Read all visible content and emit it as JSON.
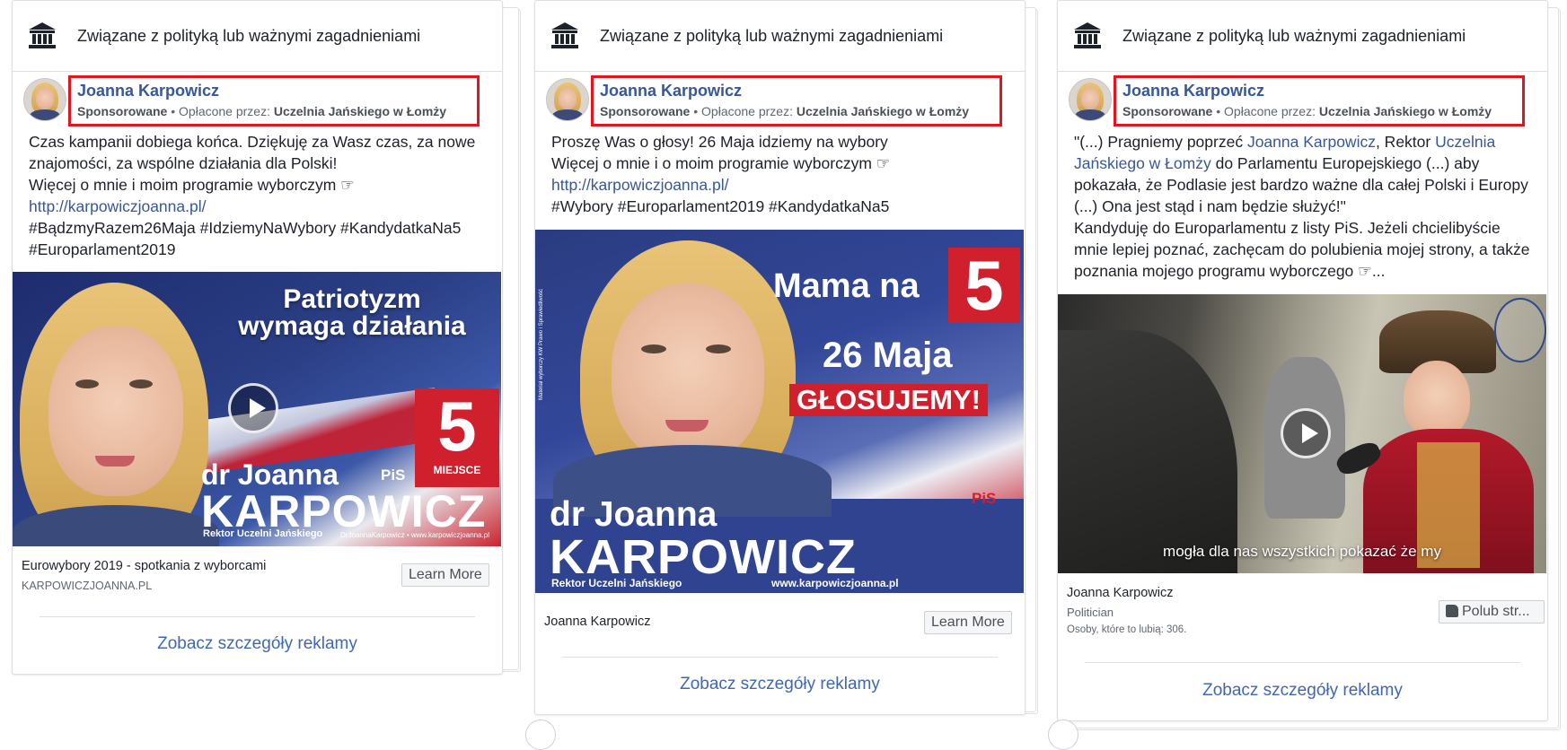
{
  "cards": [
    {
      "topbar_text": "Związane z polityką lub ważnymi zagadnieniami",
      "page_name": "Joanna Karpowicz",
      "sponsored": "Sponsorowane",
      "paid_by_label": " • Opłacone przez: ",
      "payer": "Uczelnia Jańskiego w Łomży",
      "text_lines": [
        "Czas kampanii dobiega końca. Dziękuję za Wasz czas, za nowe",
        "znajomości, za wspólne działania dla Polski!",
        "Więcej o mnie i moim programie wyborczym ☞",
        "http://karpowiczjoanna.pl/",
        "#BądzmyRazem26Maja #IdziemyNaWybory #KandydatkaNa5",
        "#Europarlament2019"
      ],
      "media": {
        "headline_1": "Patriotyzm",
        "headline_2": "wymaga działania",
        "number": "5",
        "number_sub": "MIEJSCE",
        "name_1": "dr Joanna",
        "name_2": "KARPOWICZ",
        "subtitle": "Rektor Uczelni Jańskiego",
        "handles": "DrJoannaKarpowicz  •  www.karpowiczjoanna.pl",
        "party": "PiS"
      },
      "footer_title": "Eurowybory 2019 - spotkania z wyborcami",
      "footer_sub": "KARPOWICZJOANNA.PL",
      "button": "Learn More",
      "details": "Zobacz szczegóły reklamy"
    },
    {
      "topbar_text": "Związane z polityką lub ważnymi zagadnieniami",
      "page_name": "Joanna Karpowicz",
      "sponsored": "Sponsorowane",
      "paid_by_label": " • Opłacone przez: ",
      "payer": "Uczelnia Jańskiego w Łomży",
      "text_lines": [
        "Proszę Was o głosy! 26 Maja idziemy na wybory",
        "Więcej o mnie i o moim programie wyborczym ☞",
        "http://karpowiczjoanna.pl/",
        "#Wybory #Europarlament2019 #KandydatkaNa5"
      ],
      "media": {
        "headline_1": "Mama na",
        "number": "5",
        "date": "26 Maja",
        "vote": "GŁOSUJEMY!",
        "name_1": "dr Joanna",
        "name_2": "KARPOWICZ",
        "subtitle": "Rektor Uczelni Jańskiego",
        "website": "www.karpowiczjoanna.pl",
        "party": "PiS",
        "side_note": "Materiał wyborczy KW Prawo i Sprawiedliwość"
      },
      "footer_title": "Joanna Karpowicz",
      "button": "Learn More",
      "details": "Zobacz szczegóły reklamy"
    },
    {
      "topbar_text": "Związane z polityką lub ważnymi zagadnieniami",
      "page_name": "Joanna Karpowicz",
      "sponsored": "Sponsorowane",
      "paid_by_label": " • Opłacone przez: ",
      "payer": "Uczelnia Jańskiego w Łomży",
      "text_parts": {
        "l1a": "\"(...) Pragniemy poprzeć ",
        "l1b": "Joanna Karpowicz",
        "l1c": ", Rektor ",
        "l1d": "Uczelnia",
        "l2a": "Jańskiego w Łomży",
        "l2b": " do Parlamentu Europejskiego (...) aby",
        "l3": "pokazała, że Podlasie jest bardzo ważne dla całej Polski i Europy",
        "l4": "(...) Ona jest stąd i nam będzie służyć!\"",
        "l5": "Kandyduję do Europarlamentu z listy PiS. Jeżeli chcielibyście",
        "l6": "mnie lepiej poznać, zachęcam do polubienia mojej strony, a także",
        "l7": "poznania mojego programu wyborczego ☞..."
      },
      "media": {
        "caption": "mogła dla nas wszystkich pokazać że my"
      },
      "footer_title": "Joanna Karpowicz",
      "footer_category": "Politician",
      "footer_likes": "Osoby, które to lubią: 306.",
      "button": "Polub str...",
      "details": "Zobacz szczegóły reklamy"
    }
  ],
  "colors": {
    "link": "#365899",
    "details_link": "#4267b2",
    "highlight_box": "#e0161f",
    "poster_red": "#d0202e",
    "poster_navy": "#2b3f86"
  }
}
